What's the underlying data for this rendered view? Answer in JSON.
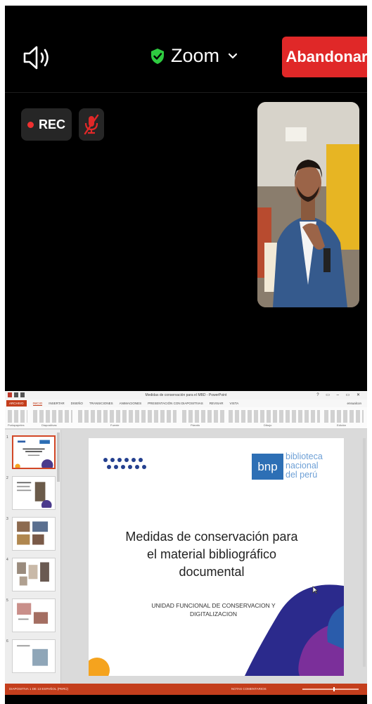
{
  "meeting": {
    "app_title": "Zoom",
    "leave_label": "Abandonar",
    "rec_label": "REC"
  },
  "shared_screen": {
    "titlebar": {
      "document": "Medidas de conservación para el MBD - PowerPoint",
      "window_controls": "? ▭ – ▭ ✕"
    },
    "tabs": [
      "ARCHIVO",
      "INICIO",
      "INSERTAR",
      "DISEÑO",
      "TRANSICIONES",
      "ANIMACIONES",
      "PRESENTACIÓN CON DIAPOSITIVAS",
      "REVISAR",
      "VISTA"
    ],
    "active_tab": "INICIO",
    "user": "ensualcon",
    "ribbon_groups": [
      "Portapapeles",
      "Diapositivas",
      "Fuente",
      "Párrafo",
      "Dibujo",
      "Edición"
    ],
    "slide_numbers": [
      "1",
      "2",
      "3",
      "4",
      "5",
      "6"
    ],
    "slide": {
      "logo_abbr": "bnp",
      "logo_lines": [
        "biblioteca",
        "nacional",
        "del perú"
      ],
      "title_lines": [
        "Medidas de conservación para",
        "el material bibliográfico",
        "documental"
      ],
      "subtitle_lines": [
        "UNIDAD FUNCIONAL DE CONSERVACION Y",
        "DIGITALIZACION"
      ]
    },
    "status": {
      "left": "DIAPOSITIVA 1 DE 13     ESPAÑOL (PERÚ)",
      "mid": "NOTAS    COMENTARIOS"
    }
  },
  "colors": {
    "leave": "#e02828",
    "shield": "#2ecc40",
    "powerpoint_accent": "#c43e1c",
    "bnp_blue": "#2d6fb5"
  },
  "icons": [
    "speaker-icon",
    "shield-check-icon",
    "chevron-down-icon",
    "mic-muted-icon"
  ]
}
